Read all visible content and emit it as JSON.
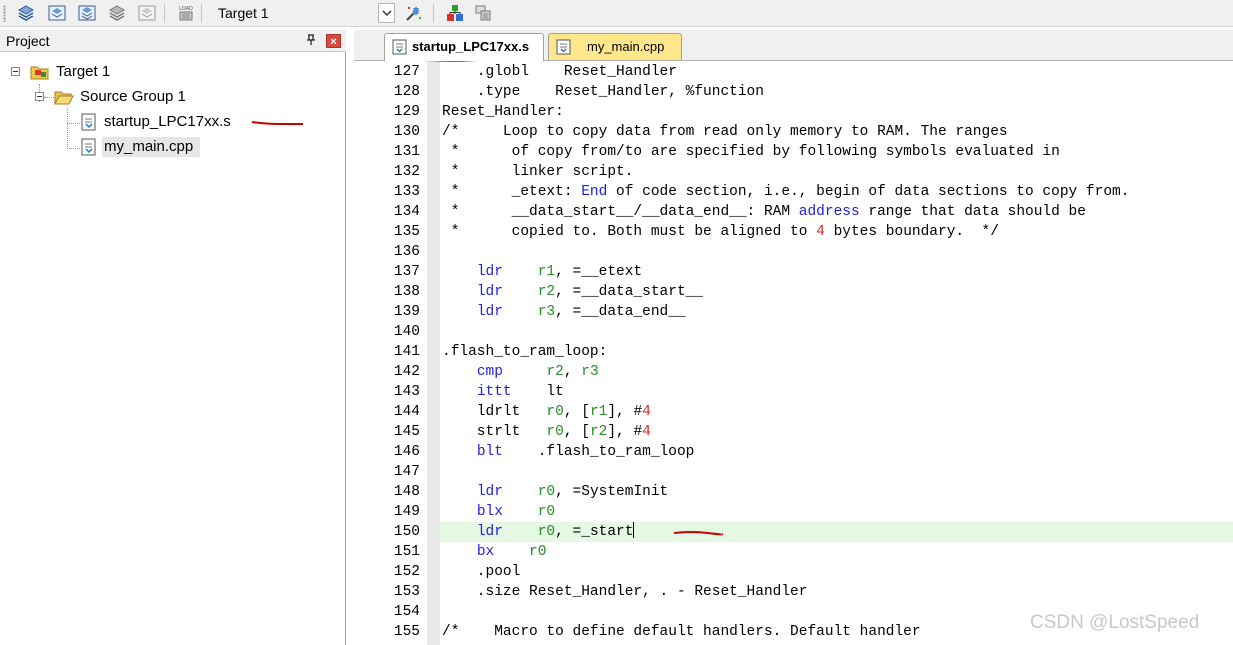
{
  "toolbar": {
    "buttons": [
      "translate-icon",
      "build-icon",
      "rebuild-icon",
      "batch-build-icon",
      "stop-build-icon",
      "download-icon",
      "target-options-icon",
      "manage-components-icon",
      "select-packs-icon"
    ],
    "target_value": "Target 1"
  },
  "project_panel": {
    "title": "Project",
    "pin_glyph": "ᵖ",
    "close_glyph": "×",
    "tree": {
      "target": "Target 1",
      "group": "Source Group 1",
      "files": [
        "startup_LPC17xx.s",
        "my_main.cpp"
      ]
    }
  },
  "editor": {
    "tabs": [
      {
        "label": "startup_LPC17xx.s",
        "active": true
      },
      {
        "label": "my_main.cpp",
        "active": false
      }
    ],
    "current_line": 150,
    "lines": [
      {
        "n": "127",
        "parts": [
          {
            "t": "    .globl    Reset_Handler"
          }
        ]
      },
      {
        "n": "128",
        "parts": [
          {
            "t": "    .type    Reset_Handler, %function"
          }
        ]
      },
      {
        "n": "129",
        "parts": [
          {
            "t": "Reset_Handler:"
          }
        ]
      },
      {
        "n": "130",
        "parts": [
          {
            "t": "/*     Loop to copy data from read only memory to RAM. The ranges"
          }
        ]
      },
      {
        "n": "131",
        "parts": [
          {
            "t": " *      of copy from/to are specified by following symbols evaluated in"
          }
        ]
      },
      {
        "n": "132",
        "parts": [
          {
            "t": " *      linker script."
          }
        ]
      },
      {
        "n": "133",
        "parts": [
          {
            "t": " *      _etext: "
          },
          {
            "t": "End",
            "c": "kw"
          },
          {
            "t": " of code section, i.e., begin of data sections to copy from."
          }
        ]
      },
      {
        "n": "134",
        "parts": [
          {
            "t": " *      __data_start__/__data_end__: RAM "
          },
          {
            "t": "address",
            "c": "kw"
          },
          {
            "t": " range that data should be"
          }
        ]
      },
      {
        "n": "135",
        "parts": [
          {
            "t": " *      copied to. Both must be aligned to "
          },
          {
            "t": "4",
            "c": "num"
          },
          {
            "t": " bytes boundary.  */"
          }
        ]
      },
      {
        "n": "136",
        "parts": [
          {
            "t": ""
          }
        ]
      },
      {
        "n": "137",
        "parts": [
          {
            "t": "    "
          },
          {
            "t": "ldr",
            "c": "kw"
          },
          {
            "t": "    "
          },
          {
            "t": "r1",
            "c": "reg"
          },
          {
            "t": ", =__etext"
          }
        ]
      },
      {
        "n": "138",
        "parts": [
          {
            "t": "    "
          },
          {
            "t": "ldr",
            "c": "kw"
          },
          {
            "t": "    "
          },
          {
            "t": "r2",
            "c": "reg"
          },
          {
            "t": ", =__data_start__"
          }
        ]
      },
      {
        "n": "139",
        "parts": [
          {
            "t": "    "
          },
          {
            "t": "ldr",
            "c": "kw"
          },
          {
            "t": "    "
          },
          {
            "t": "r3",
            "c": "reg"
          },
          {
            "t": ", =__data_end__"
          }
        ]
      },
      {
        "n": "140",
        "parts": [
          {
            "t": ""
          }
        ]
      },
      {
        "n": "141",
        "parts": [
          {
            "t": ".flash_to_ram_loop:"
          }
        ]
      },
      {
        "n": "142",
        "parts": [
          {
            "t": "    "
          },
          {
            "t": "cmp",
            "c": "kw"
          },
          {
            "t": "     "
          },
          {
            "t": "r2",
            "c": "reg"
          },
          {
            "t": ", "
          },
          {
            "t": "r3",
            "c": "reg"
          }
        ]
      },
      {
        "n": "143",
        "parts": [
          {
            "t": "    "
          },
          {
            "t": "ittt",
            "c": "kw"
          },
          {
            "t": "    lt"
          }
        ]
      },
      {
        "n": "144",
        "parts": [
          {
            "t": "    ldrlt   "
          },
          {
            "t": "r0",
            "c": "reg"
          },
          {
            "t": ", ["
          },
          {
            "t": "r1",
            "c": "reg"
          },
          {
            "t": "], #"
          },
          {
            "t": "4",
            "c": "num"
          }
        ]
      },
      {
        "n": "145",
        "parts": [
          {
            "t": "    strlt   "
          },
          {
            "t": "r0",
            "c": "reg"
          },
          {
            "t": ", ["
          },
          {
            "t": "r2",
            "c": "reg"
          },
          {
            "t": "], #"
          },
          {
            "t": "4",
            "c": "num"
          }
        ]
      },
      {
        "n": "146",
        "parts": [
          {
            "t": "    "
          },
          {
            "t": "blt",
            "c": "kw"
          },
          {
            "t": "    .flash_to_ram_loop"
          }
        ]
      },
      {
        "n": "147",
        "parts": [
          {
            "t": ""
          }
        ]
      },
      {
        "n": "148",
        "parts": [
          {
            "t": "    "
          },
          {
            "t": "ldr",
            "c": "kw"
          },
          {
            "t": "    "
          },
          {
            "t": "r0",
            "c": "reg"
          },
          {
            "t": ", =SystemInit"
          }
        ]
      },
      {
        "n": "149",
        "parts": [
          {
            "t": "    "
          },
          {
            "t": "blx",
            "c": "kw"
          },
          {
            "t": "    "
          },
          {
            "t": "r0",
            "c": "reg"
          }
        ]
      },
      {
        "n": "150",
        "parts": [
          {
            "t": "    "
          },
          {
            "t": "ldr",
            "c": "kw"
          },
          {
            "t": "    "
          },
          {
            "t": "r0",
            "c": "reg"
          },
          {
            "t": ", =_start"
          }
        ]
      },
      {
        "n": "151",
        "parts": [
          {
            "t": "    "
          },
          {
            "t": "bx",
            "c": "kw"
          },
          {
            "t": "    "
          },
          {
            "t": "r0",
            "c": "reg"
          }
        ]
      },
      {
        "n": "152",
        "parts": [
          {
            "t": "    .pool"
          }
        ]
      },
      {
        "n": "153",
        "parts": [
          {
            "t": "    .size Reset_Handler, . - Reset_Handler"
          }
        ]
      },
      {
        "n": "154",
        "parts": [
          {
            "t": ""
          }
        ]
      },
      {
        "n": "155",
        "parts": [
          {
            "t": "/*    Macro to define default handlers. Default handler"
          }
        ]
      }
    ]
  },
  "watermark": "CSDN @LostSpeed",
  "colors": {
    "keyword": "#1f1fe0",
    "register": "#2a8c2a",
    "number": "#e02020",
    "current_line": "#e4f8e4",
    "annotation": "#cc0000",
    "tab_inactive": "#fde78a"
  }
}
